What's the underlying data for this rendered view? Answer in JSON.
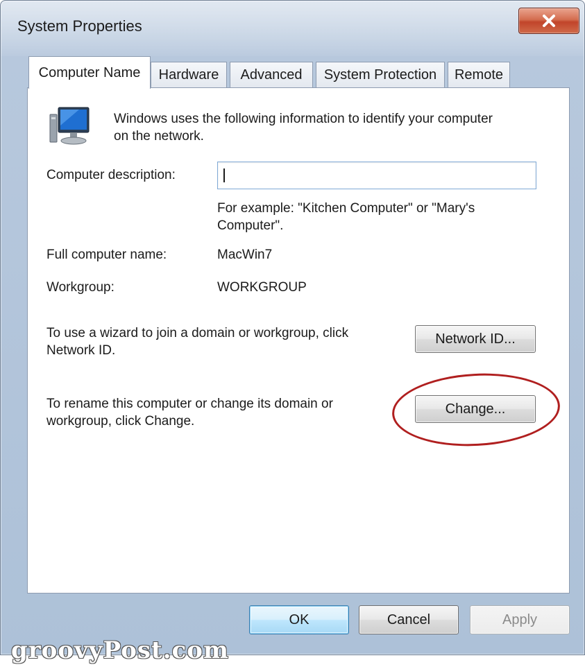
{
  "window": {
    "title": "System Properties"
  },
  "tabs": [
    {
      "label": "Computer Name",
      "active": true
    },
    {
      "label": "Hardware",
      "active": false
    },
    {
      "label": "Advanced",
      "active": false
    },
    {
      "label": "System Protection",
      "active": false
    },
    {
      "label": "Remote",
      "active": false
    }
  ],
  "panel": {
    "intro_line1": "Windows uses the following information to identify your computer",
    "intro_line2": "on the network.",
    "description_label": "Computer description:",
    "description_value": "",
    "example_line1": "For example: \"Kitchen Computer\" or \"Mary's",
    "example_line2": "Computer\".",
    "full_name_label": "Full computer name:",
    "full_name_value": "MacWin7",
    "workgroup_label": "Workgroup:",
    "workgroup_value": "WORKGROUP",
    "network_id_text_line1": "To use a wizard to join a domain or workgroup, click",
    "network_id_text_line2": "Network ID.",
    "network_id_button": "Network ID...",
    "change_text_line1": "To rename this computer or change its domain or",
    "change_text_line2": "workgroup, click Change.",
    "change_button": "Change..."
  },
  "footer": {
    "ok": "OK",
    "cancel": "Cancel",
    "apply": "Apply"
  },
  "watermark": "groovyPost.com",
  "icons": {
    "close": "close-icon",
    "computer": "computer-icon"
  },
  "colors": {
    "close_button": "#c1442a",
    "highlight_ring": "#b01f1f",
    "default_button_border": "#3c7fb1"
  }
}
